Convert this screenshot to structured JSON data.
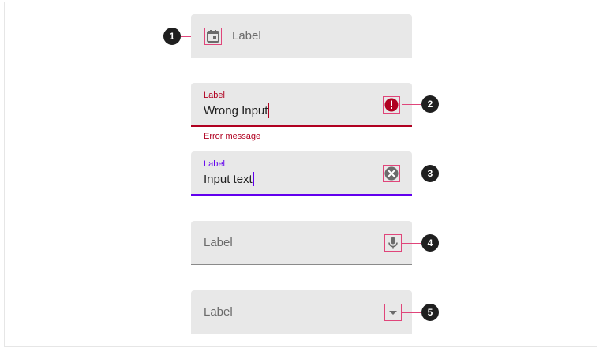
{
  "fields": [
    {
      "label": "Label",
      "leading_icon": "calendar-icon",
      "callout": "1"
    },
    {
      "label": "Label",
      "value": "Wrong Input",
      "trailing_icon": "error-icon",
      "helper_text": "Error message",
      "callout": "2",
      "state": "error"
    },
    {
      "label": "Label",
      "value": "Input text",
      "trailing_icon": "clear-icon",
      "callout": "3",
      "state": "focused"
    },
    {
      "label": "Label",
      "trailing_icon": "mic-icon",
      "callout": "4"
    },
    {
      "label": "Label",
      "trailing_icon": "dropdown-arrow-icon",
      "callout": "5"
    }
  ],
  "colors": {
    "error": "#b00020",
    "focus": "#6200ee",
    "annotation": "#e0457a",
    "field_bg": "#e8e8e8"
  }
}
